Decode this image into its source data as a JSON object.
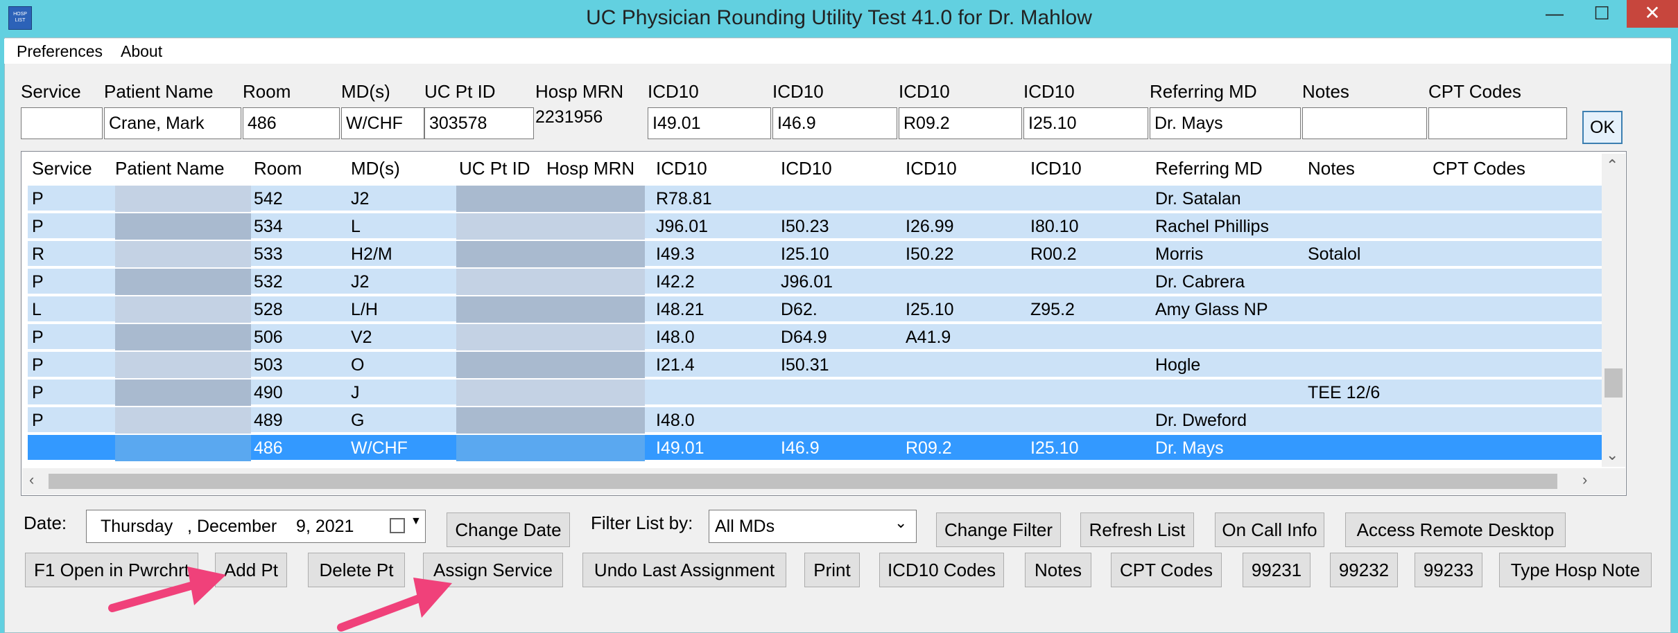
{
  "window": {
    "title": "UC Physician Rounding Utility Test 41.0 for Dr. Mahlow",
    "icon_text": "HOSP LIST",
    "controls": {
      "minimize": "—",
      "maximize": "☐",
      "close": "✕"
    }
  },
  "menu": [
    "Preferences",
    "About"
  ],
  "entry": {
    "labels": [
      "Service",
      "Patient Name",
      "Room",
      "MD(s)",
      "UC Pt ID",
      "Hosp MRN",
      "ICD10",
      "ICD10",
      "ICD10",
      "ICD10",
      "Referring MD",
      "Notes",
      "CPT Codes"
    ],
    "values": {
      "service": "",
      "patient_name": "Crane, Mark",
      "room": "486",
      "mds": "W/CHF",
      "uc_pt_id": "303578",
      "hosp_mrn": "2231956",
      "icd10_1": "I49.01",
      "icd10_2": "I46.9",
      "icd10_3": "R09.2",
      "icd10_4": "I25.10",
      "referring_md": "Dr. Mays",
      "notes": "",
      "cpt_codes": ""
    },
    "ok_label": "OK"
  },
  "grid": {
    "headers": [
      "Service",
      "Patient Name",
      "Room",
      "MD(s)",
      "UC Pt ID",
      "Hosp MRN",
      "ICD10",
      "ICD10",
      "ICD10",
      "ICD10",
      "Referring MD",
      "Notes",
      "CPT Codes"
    ],
    "rows": [
      {
        "service": "P",
        "room": "542",
        "mds": "J2",
        "icd1": "R78.81",
        "icd2": "",
        "icd3": "",
        "icd4": "",
        "ref": "Dr. Satalan",
        "notes": ""
      },
      {
        "service": "P",
        "room": "534",
        "mds": "L",
        "icd1": "J96.01",
        "icd2": "I50.23",
        "icd3": "I26.99",
        "icd4": "I80.10",
        "ref": "Rachel Phillips",
        "notes": ""
      },
      {
        "service": "R",
        "room": "533",
        "mds": "H2/M",
        "icd1": "I49.3",
        "icd2": "I25.10",
        "icd3": "I50.22",
        "icd4": "R00.2",
        "ref": "Morris",
        "notes": "Sotalol"
      },
      {
        "service": "P",
        "room": "532",
        "mds": "J2",
        "icd1": "I42.2",
        "icd2": "J96.01",
        "icd3": "",
        "icd4": "",
        "ref": "Dr. Cabrera",
        "notes": ""
      },
      {
        "service": "L",
        "room": "528",
        "mds": "L/H",
        "icd1": "I48.21",
        "icd2": "D62.",
        "icd3": "I25.10",
        "icd4": "Z95.2",
        "ref": "Amy Glass NP",
        "notes": ""
      },
      {
        "service": "P",
        "room": "506",
        "mds": "V2",
        "icd1": "I48.0",
        "icd2": "D64.9",
        "icd3": "A41.9",
        "icd4": "",
        "ref": "",
        "notes": ""
      },
      {
        "service": "P",
        "room": "503",
        "mds": "O",
        "icd1": "I21.4",
        "icd2": "I50.31",
        "icd3": "",
        "icd4": "",
        "ref": "Hogle",
        "notes": ""
      },
      {
        "service": "P",
        "room": "490",
        "mds": "J",
        "icd1": "",
        "icd2": "",
        "icd3": "",
        "icd4": "",
        "ref": "",
        "notes": "TEE 12/6"
      },
      {
        "service": "P",
        "room": "489",
        "mds": "G",
        "icd1": "I48.0",
        "icd2": "",
        "icd3": "",
        "icd4": "",
        "ref": "Dr. Dweford",
        "notes": ""
      },
      {
        "service": "",
        "room": "486",
        "mds": "W/CHF",
        "icd1": "I49.01",
        "icd2": "I46.9",
        "icd3": "R09.2",
        "icd4": "I25.10",
        "ref": "Dr. Mays",
        "notes": ""
      }
    ],
    "selected_row": 9
  },
  "controls": {
    "date_label": "Date:",
    "date_value": "Thursday   , December    9, 2021",
    "change_date": "Change Date",
    "filter_label": "Filter List by:",
    "filter_value": "All MDs",
    "change_filter": "Change Filter",
    "refresh_list": "Refresh List",
    "on_call_info": "On Call Info",
    "access_remote": "Access Remote Desktop"
  },
  "buttons": [
    "F1 Open in Pwrchrt",
    "Add Pt",
    "Delete Pt",
    "Assign Service",
    "Undo Last Assignment",
    "Print",
    "ICD10 Codes",
    "Notes",
    "CPT Codes",
    "99231",
    "99232",
    "99233",
    "Type Hosp Note"
  ],
  "colors": {
    "title_bar": "#62d0e0",
    "row": "#cce2f7",
    "selected": "#3399ff",
    "arrow": "#f0417a"
  }
}
